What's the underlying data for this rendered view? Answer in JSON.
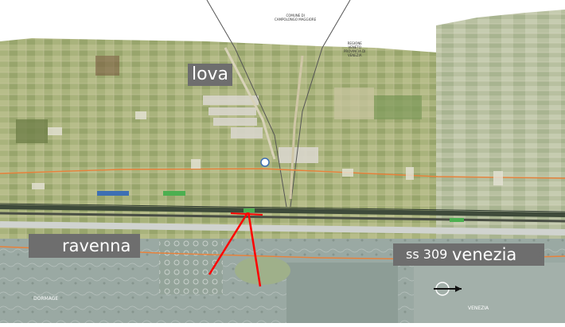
{
  "labels": {
    "lova": "lova",
    "ravenna": "ravenna",
    "road": "ss 309",
    "venezia": "venezia"
  },
  "annotations": {
    "comune_line1": "COMUNE DI",
    "comune_line2": "CAMPOLONGO MAGGIORE",
    "regione_line1": "REGIONE",
    "regione_line2": "VENETO",
    "regione_line3": "PROVINCIA DI",
    "regione_line4": "VENEZIA",
    "bottom_left": "DORMAGE",
    "bottom_right": "VENEZIA"
  },
  "colors": {
    "farmland": "#a9b37c",
    "lagoon": "#9aa9a3",
    "highlight_line": "#ff0000",
    "boundary_line": "#e8813a",
    "label_bg": "#6e6e6e"
  },
  "icons": {
    "north_arrow": "compass-arrow-icon",
    "junction_marker": "circle-marker-icon"
  }
}
